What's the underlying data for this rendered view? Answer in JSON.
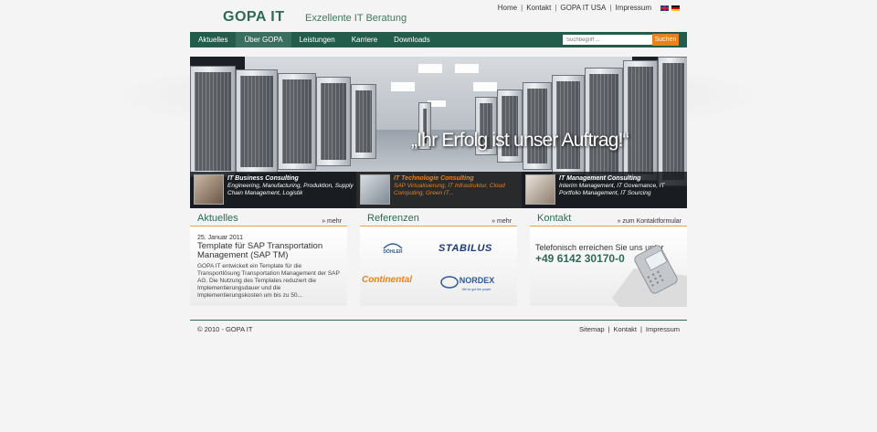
{
  "header": {
    "logo": "GOPA IT",
    "slogan": "Exzellente IT Beratung",
    "top_links": [
      "Home",
      "Kontakt",
      "GOPA IT USA",
      "Impressum"
    ]
  },
  "nav": {
    "items": [
      "Aktuelles",
      "Über GOPA",
      "Leistungen",
      "Karriere",
      "Downloads"
    ],
    "active_index": 1
  },
  "search": {
    "placeholder": "Suchbegriff ...",
    "button_label": "Suchen"
  },
  "banner": {
    "tagline": "„Ihr Erfolg ist unser Auftrag!“",
    "services": [
      {
        "title": "IT Business Consulting",
        "description": "Engineering, Manufacturing, Produktion, Supply Chain Management, Logistik"
      },
      {
        "title": "IT Technologie Consulting",
        "description": "SAP Virtualisierung, IT Infrastruktur, Cloud Computing, Green IT..."
      },
      {
        "title": "IT Management Consulting",
        "description": "Interim Management, IT Governance, IT Portfolio Management, IT Sourcing"
      }
    ]
  },
  "panels": {
    "news": {
      "title": "Aktuelles",
      "more": "» mehr",
      "date": "25. Januar 2011",
      "headline": "Template für SAP Transportation Management (SAP TM)",
      "text": "GOPA IT entwickelt ein Template für die Transportlösung Transportation Management der SAP AG. Die Nutzung des Templates reduziert die Implementierungsdauer und die Implementierungskosten um bis zu 50..."
    },
    "references": {
      "title": "Referenzen",
      "more": "» mehr",
      "logos": {
        "doehler": "DÖHLER",
        "stabilus": "STABILUS",
        "continental": "Continental",
        "nordex": "NORDEX",
        "nordex_sub": "We've got the power."
      }
    },
    "contact": {
      "title": "Kontakt",
      "more": "» zum Kontaktformular",
      "text": "Telefonisch erreichen Sie uns unter",
      "phone": "+49 6142 30170-0"
    }
  },
  "footer": {
    "copyright": "© 2010 - GOPA IT",
    "links": [
      "Sitemap",
      "Kontakt",
      "Impressum"
    ]
  },
  "colors": {
    "brand_green": "#2d6a53",
    "nav_bg": "#245c4c",
    "accent_orange": "#e8821e"
  }
}
